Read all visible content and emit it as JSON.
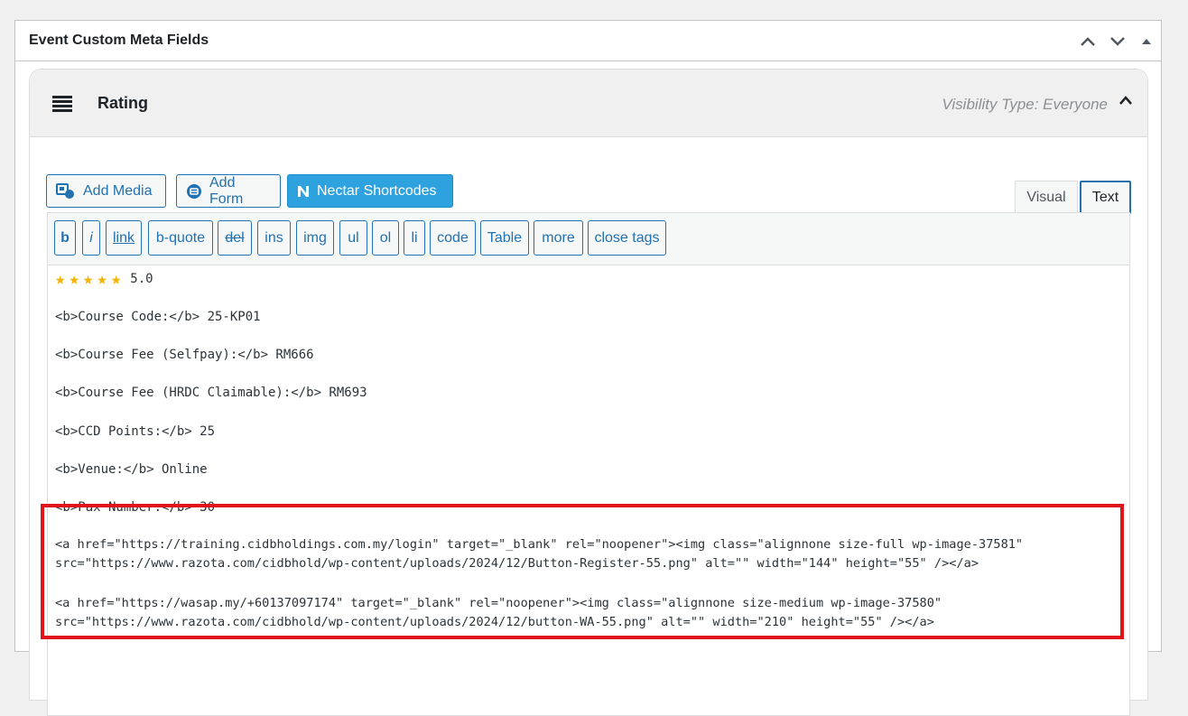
{
  "postbox": {
    "title": "Event Custom Meta Fields"
  },
  "field": {
    "label": "Rating",
    "visibility": "Visibility Type: Everyone"
  },
  "media_buttons": {
    "add_media": "Add Media",
    "add_form": "Add Form",
    "nectar": "Nectar Shortcodes"
  },
  "tabs": {
    "visual": "Visual",
    "text": "Text"
  },
  "quicktags": [
    "b",
    "i",
    "link",
    "b-quote",
    "del",
    "ins",
    "img",
    "ul",
    "ol",
    "li",
    "code",
    "Table",
    "more",
    "close tags"
  ],
  "content": {
    "rating_value": "5.0",
    "lines": [
      "<b>Course Code:</b> 25-KP01",
      "<b>Course Fee (Selfpay):</b> RM666",
      "<b>Course Fee (HRDC Claimable):</b> RM693",
      "<b>CCD Points:</b> 25",
      "<b>Venue:</b> Online",
      "<b>Pax Number:</b> 30"
    ],
    "link1_a": "<a href=\"https://training.cidbholdings.com.my/login\" target=\"_blank\" rel=\"noopener\"><img class=\"alignnone size-full wp-image-37581\"",
    "link1_b": "src=\"https://www.razota.com/cidbhold/wp-content/uploads/2024/12/Button-Register-55.png\" alt=\"\" width=\"144\" height=\"55\" /></a>",
    "link2_a": "<a href=\"https://wasap.my/+60137097174\" target=\"_blank\" rel=\"noopener\"><img class=\"alignnone size-medium wp-image-37580\"",
    "link2_b": "src=\"https://www.razota.com/cidbhold/wp-content/uploads/2024/12/button-WA-55.png\" alt=\"\" width=\"210\" height=\"55\" /></a>"
  },
  "colors": {
    "accent": "#2271b1",
    "nectar": "#2ea2df",
    "highlight": "#e0151b",
    "star": "#f5b301"
  }
}
